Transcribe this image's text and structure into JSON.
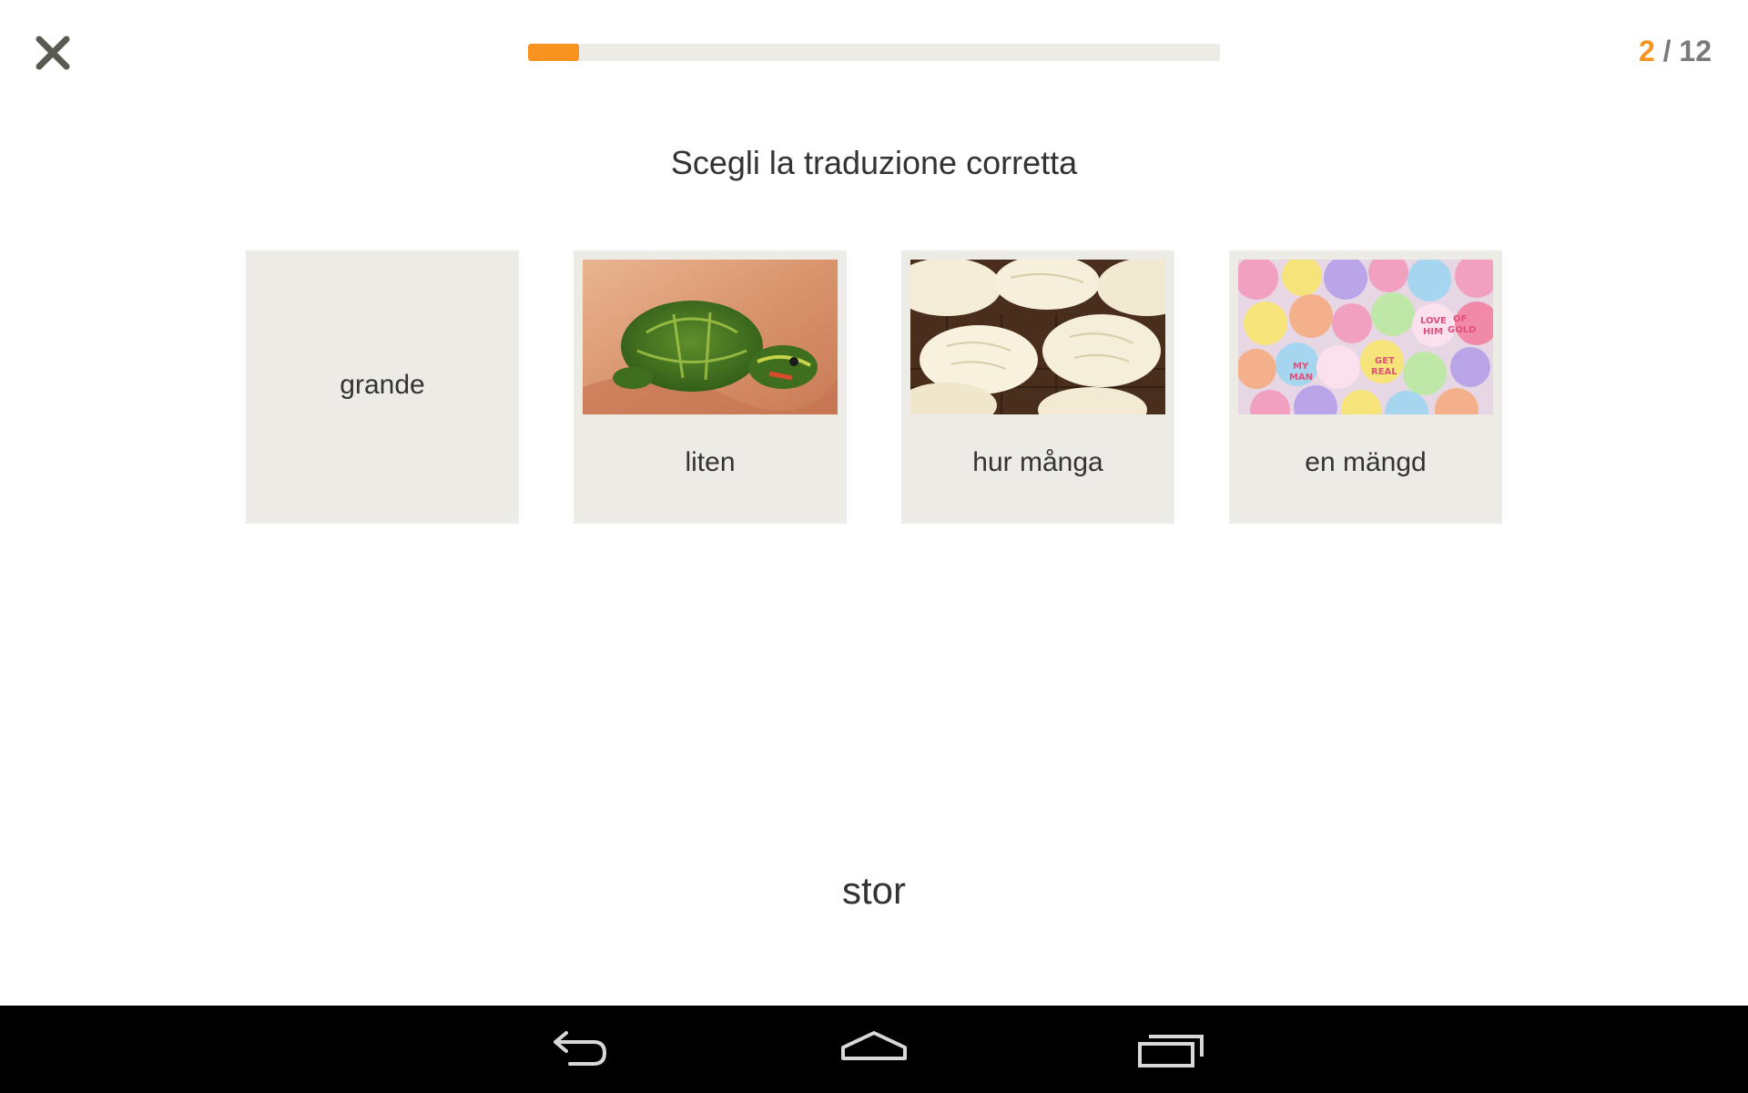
{
  "header": {
    "progress_fraction": 0.074,
    "counter_current": "2",
    "counter_sep": " / ",
    "counter_total": "12"
  },
  "instruction": "Scegli la traduzione corretta",
  "options": [
    {
      "label": "grande",
      "image": null
    },
    {
      "label": "liten",
      "image": "turtle-photo"
    },
    {
      "label": "hur många",
      "image": "cupcakes-photo"
    },
    {
      "label": "en mängd",
      "image": "candy-hearts-photo"
    }
  ],
  "prompt_word": "stor",
  "colors": {
    "accent": "#f7931e",
    "card_bg": "#ecebe5",
    "text": "#333333",
    "navbar": "#000000"
  },
  "navbar": {
    "buttons": [
      "back-icon",
      "home-icon",
      "recent-apps-icon"
    ]
  }
}
